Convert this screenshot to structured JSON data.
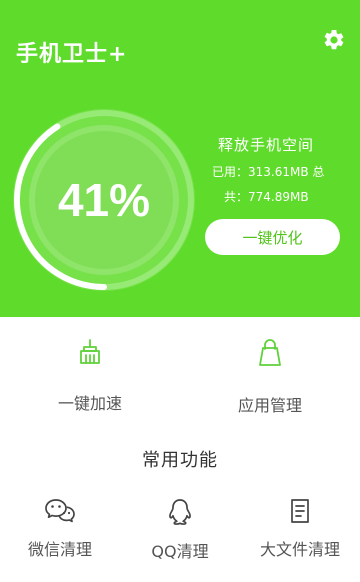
{
  "app": {
    "title": "手机卫士+",
    "icons": {
      "settings": "gear-icon"
    }
  },
  "memory": {
    "percent_label": "41%",
    "usage_fraction": 0.41,
    "title": "释放手机空间",
    "used_text": "已用：313.61MB 总",
    "total_text": "共：774.89MB",
    "optimize_button": "一键优化"
  },
  "primary_functions": [
    {
      "label": "一键加速",
      "icon": "broom-icon"
    },
    {
      "label": "应用管理",
      "icon": "bag-icon"
    }
  ],
  "common": {
    "title": "常用功能",
    "items": [
      {
        "label": "微信清理",
        "icon": "wechat-icon"
      },
      {
        "label": "QQ清理",
        "icon": "qq-icon"
      },
      {
        "label": "大文件清理",
        "icon": "document-icon"
      }
    ]
  },
  "colors": {
    "header_green": "#5fdb2c",
    "accent_green": "#52c41a"
  }
}
